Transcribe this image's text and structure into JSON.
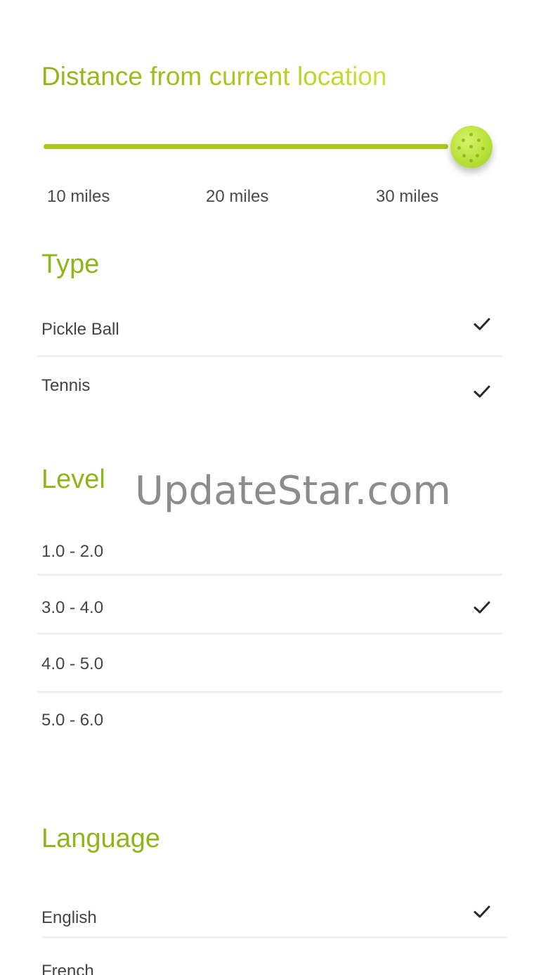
{
  "distance": {
    "title": "Distance from current location",
    "tick_labels": [
      "10 miles",
      "20 miles",
      "30 miles"
    ],
    "slider_value_percent": 100
  },
  "type": {
    "title": "Type",
    "options": [
      {
        "label": "Pickle Ball",
        "checked": true
      },
      {
        "label": "Tennis",
        "checked": true
      }
    ]
  },
  "level": {
    "title": "Level",
    "options": [
      {
        "label": "1.0 - 2.0",
        "checked": false
      },
      {
        "label": "3.0 - 4.0",
        "checked": true
      },
      {
        "label": "4.0 - 5.0",
        "checked": false
      },
      {
        "label": "5.0 - 6.0",
        "checked": false
      }
    ]
  },
  "language": {
    "title": "Language",
    "options": [
      {
        "label": "English",
        "checked": true
      },
      {
        "label": "French",
        "checked": false
      }
    ]
  },
  "watermark": "UpdateStar.com",
  "colors": {
    "accent": "#8eb51a",
    "slider": "#a9c91b",
    "thumb": "#b8e23a",
    "check": "#2a2a2a",
    "divider": "#eef1f3"
  },
  "icons": {
    "check": "checkmark-icon",
    "thumb": "pickleball-icon"
  }
}
